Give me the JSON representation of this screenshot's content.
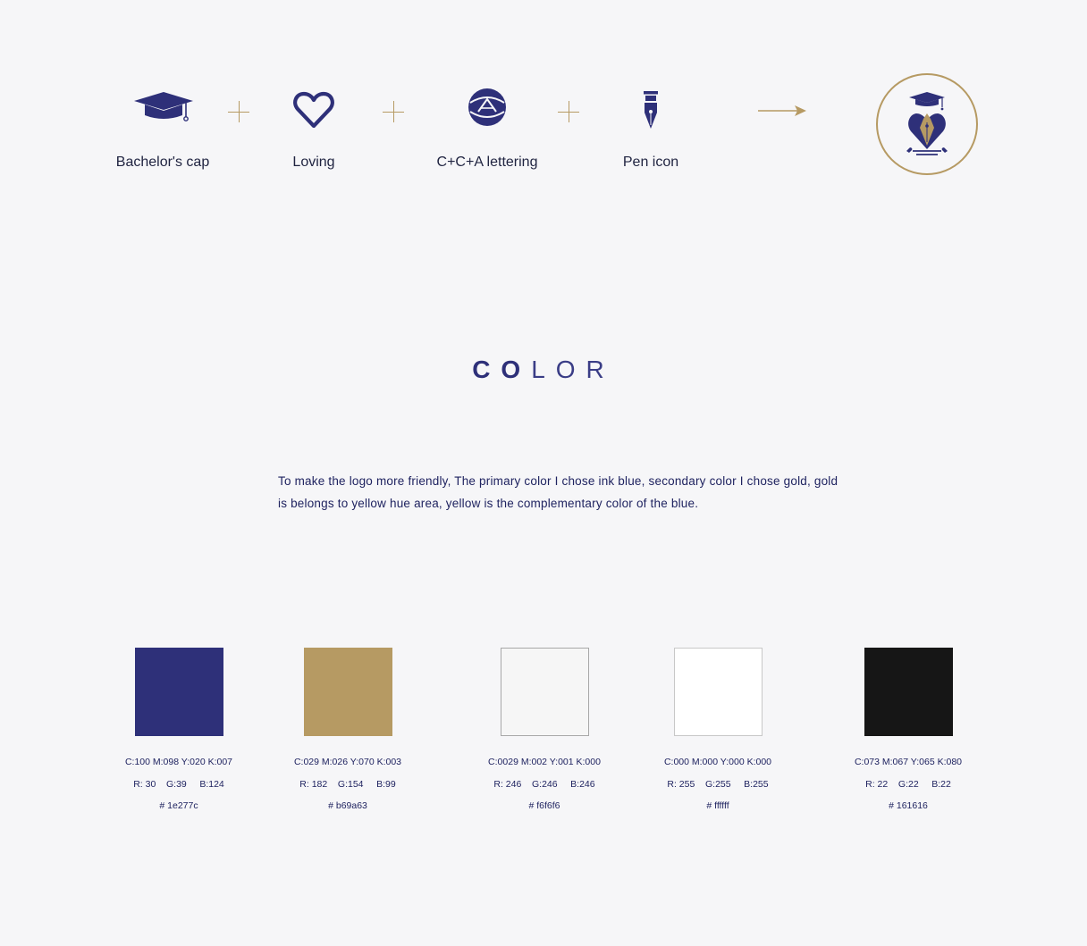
{
  "elements": [
    {
      "label": "Bachelor's cap"
    },
    {
      "label": "Loving"
    },
    {
      "label": "C+C+A lettering"
    },
    {
      "label": "Pen icon"
    }
  ],
  "section_title": {
    "part_bold": "CO",
    "part_light": "LOR"
  },
  "description": "To make the logo more friendly, The primary color I chose ink blue, secondary color I chose gold,  gold is belongs to yellow hue area, yellow is the complementary color of the blue.",
  "swatches": [
    {
      "cmyk": "C:100 M:098 Y:020 K:007",
      "rgb": "R: 30    G:39     B:124",
      "hex": "# 1e277c",
      "color": "#2e3079",
      "border": "none"
    },
    {
      "cmyk": "C:029 M:026 Y:070 K:003",
      "rgb": "R: 182    G:154     B:99",
      "hex": "# b69a63",
      "color": "#b69a63",
      "border": "none"
    },
    {
      "cmyk": "C:0029 M:002 Y:001 K:000",
      "rgb": "R: 246    G:246     B:246",
      "hex": "# f6f6f6",
      "color": "#f6f6f6",
      "border": "#a8a8a8"
    },
    {
      "cmyk": "C:000 M:000 Y:000 K:000",
      "rgb": "R: 255    G:255     B:255",
      "hex": "# ffffff",
      "color": "#ffffff",
      "border": "#c8c8c8"
    },
    {
      "cmyk": "C:073 M:067 Y:065 K:080",
      "rgb": "R: 22    G:22     B:22",
      "hex": "# 161616",
      "color": "#161616",
      "border": "none"
    }
  ],
  "colors": {
    "ink_blue": "#2e3079",
    "gold": "#b69a63",
    "background": "#f6f6f8"
  },
  "icons": [
    "graduation-cap-icon",
    "heart-icon",
    "cca-lettering-icon",
    "fountain-pen-icon",
    "arrow-right-icon",
    "combined-logo-icon"
  ]
}
